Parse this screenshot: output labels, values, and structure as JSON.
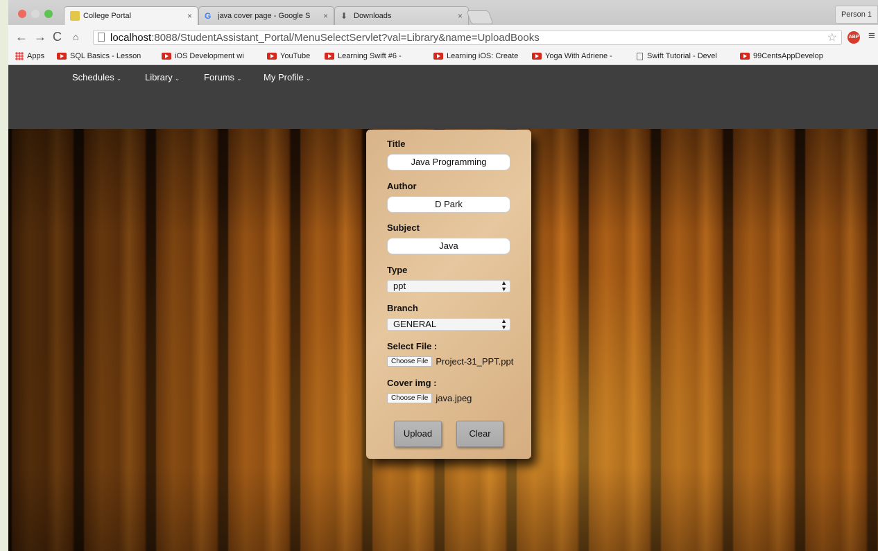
{
  "tabs": [
    {
      "label": "College Portal",
      "active": true
    },
    {
      "label": "java cover page - Google S",
      "active": false
    },
    {
      "label": "Downloads",
      "active": false
    }
  ],
  "person_button": "Person 1",
  "url": {
    "host": "localhost",
    "rest": ":8088/StudentAssistant_Portal/MenuSelectServlet?val=Library&name=UploadBooks"
  },
  "extension_badge": "ABP",
  "bookmarks": [
    {
      "label": "Apps",
      "icon": "apps-icon"
    },
    {
      "label": "SQL Basics - Lesson",
      "icon": "youtube-icon"
    },
    {
      "label": "iOS Development wi",
      "icon": "youtube-icon"
    },
    {
      "label": "YouTube",
      "icon": "youtube-icon"
    },
    {
      "label": "Learning Swift #6 - ",
      "icon": "youtube-icon"
    },
    {
      "label": "Learning iOS: Create",
      "icon": "youtube-icon"
    },
    {
      "label": "Yoga With Adriene - ",
      "icon": "youtube-icon"
    },
    {
      "label": "Swift Tutorial - Devel",
      "icon": "document-icon"
    },
    {
      "label": "99CentsAppDevelop",
      "icon": "youtube-icon"
    }
  ],
  "site_nav": [
    {
      "label": "Schedules"
    },
    {
      "label": "Library"
    },
    {
      "label": "Forums"
    },
    {
      "label": "My Profile"
    }
  ],
  "form": {
    "title_label": "Title",
    "title_value": "Java Programming",
    "author_label": "Author",
    "author_value": "D Park",
    "subject_label": "Subject",
    "subject_value": "Java",
    "type_label": "Type",
    "type_value": "ppt",
    "branch_label": "Branch",
    "branch_value": "GENERAL",
    "file_label": "Select File :",
    "file_button": "Choose File",
    "file_name": "Project-31_PPT.ppt",
    "cover_label": "Cover img :",
    "cover_button": "Choose File",
    "cover_name": "java.jpeg",
    "upload_button": "Upload",
    "clear_button": "Clear"
  },
  "colors": {
    "nav_bar": "#3f3f3f",
    "form_panel": "#e0bf95",
    "youtube_red": "#d6281c",
    "abp_red": "#d93a2b"
  }
}
